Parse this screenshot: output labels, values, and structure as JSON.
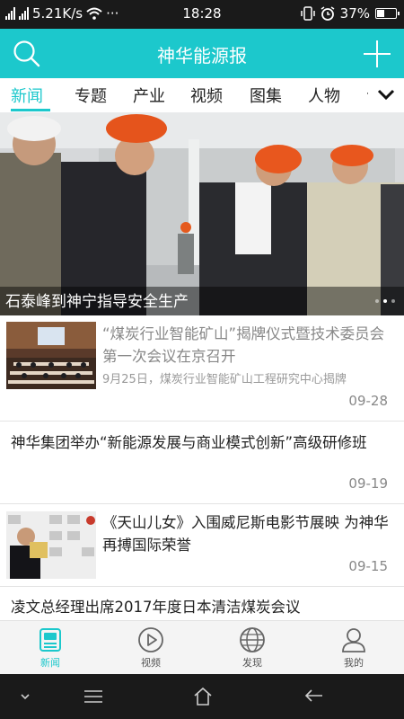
{
  "status_bar": {
    "network": "5.21K/s",
    "more": "···",
    "time": "18:28",
    "battery": "37%"
  },
  "header": {
    "title": "神华能源报",
    "search_icon": "search-icon",
    "add_icon": "plus-icon"
  },
  "tabs": [
    {
      "label": "新闻",
      "active": true
    },
    {
      "label": "专题"
    },
    {
      "label": "产业"
    },
    {
      "label": "视频"
    },
    {
      "label": "图集"
    },
    {
      "label": "人物"
    },
    {
      "label": "专"
    }
  ],
  "banner": {
    "caption": "石泰峰到神宁指导安全生产",
    "page_count": 3,
    "active_page": 1
  },
  "news": [
    {
      "title": "“煤炭行业智能矿山”揭牌仪式暨技术委员会第一次会议在京召开",
      "summary": "9月25日，煤炭行业智能矿山工程研究中心揭牌",
      "date": "09-28",
      "read": true
    },
    {
      "title": "神华集团举办“新能源发展与商业模式创新”高级研修班",
      "date": "09-19"
    },
    {
      "title": "《天山儿女》入围威尼斯电影节展映 为神华再搏国际荣誉",
      "date": "09-15"
    },
    {
      "title": "凌文总经理出席2017年度日本清洁煤炭会议"
    }
  ],
  "bottom_nav": [
    {
      "label": "新闻",
      "icon": "newspaper-icon",
      "active": true
    },
    {
      "label": "视频",
      "icon": "play-icon"
    },
    {
      "label": "发现",
      "icon": "globe-icon"
    },
    {
      "label": "我的",
      "icon": "user-icon"
    }
  ],
  "colors": {
    "accent": "#1cc8cc",
    "status_bar": "#1a1a1a",
    "text": "#222222",
    "muted": "#888888"
  }
}
